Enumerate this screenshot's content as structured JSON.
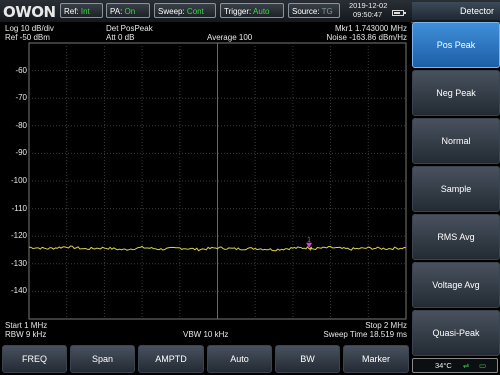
{
  "brand": {
    "logo_text": "OWON"
  },
  "topbar": {
    "ref": {
      "label": "Ref:",
      "value": "Int"
    },
    "pa": {
      "label": "PA:",
      "value": "On"
    },
    "sweep": {
      "label": "Sweep:",
      "value": "Cont"
    },
    "trigger": {
      "label": "Trigger:",
      "value": "Auto"
    },
    "source": {
      "label": "Source:",
      "value": "TG"
    },
    "date": "2019-12-02",
    "time": "09:50:47"
  },
  "menu": {
    "title": "Detector",
    "items": [
      {
        "label": "Pos Peak",
        "active": true
      },
      {
        "label": "Neg Peak"
      },
      {
        "label": "Normal"
      },
      {
        "label": "Sample"
      },
      {
        "label": "RMS Avg"
      },
      {
        "label": "Voltage Avg"
      },
      {
        "label": "Quasi-Peak"
      }
    ]
  },
  "screen_header": {
    "scale": "Log 10 dB/div",
    "ref_level": "Ref -50 dBm",
    "detector": "Det PosPeak",
    "attenuation": "Att 0 dB",
    "average": "Average 100",
    "marker_freq": "Mkr1  1.743000 MHz",
    "noise": "Noise  -163.86 dBm/Hz"
  },
  "screen_footer": {
    "start": "Start 1 MHz",
    "rbw": "RBW 9 kHz",
    "vbw": "VBW 10 kHz",
    "stop": "Stop 2 MHz",
    "sweep_time": "Sweep Time 18.519 ms"
  },
  "bottom_menu": [
    {
      "label": "FREQ"
    },
    {
      "label": "Span"
    },
    {
      "label": "AMPTD"
    },
    {
      "label": "Auto"
    },
    {
      "label": "BW"
    },
    {
      "label": "Marker"
    }
  ],
  "status": {
    "temperature": "34°C"
  },
  "marker": {
    "label": "1"
  },
  "colors": {
    "trace": "#d8d24a",
    "marker": "#e040d0",
    "active_button": "#2f7fcf",
    "status_green": "#3fd34a"
  },
  "chart_data": {
    "type": "line",
    "title": "",
    "xlabel": "",
    "ylabel": "",
    "x_unit": "MHz",
    "y_unit": "dBm",
    "xlim": [
      1,
      2
    ],
    "ylim": [
      -150,
      -50
    ],
    "y_ticks": [
      -60,
      -70,
      -80,
      -90,
      -100,
      -110,
      -120,
      -130,
      -140
    ],
    "grid": true,
    "series": [
      {
        "x": [
          1.0,
          1.05,
          1.1,
          1.15,
          1.2,
          1.25,
          1.3,
          1.35,
          1.4,
          1.45,
          1.5,
          1.55,
          1.6,
          1.65,
          1.7,
          1.743,
          1.75,
          1.8,
          1.85,
          1.9,
          1.95,
          2.0
        ],
        "y": [
          -124,
          -124.5,
          -123.8,
          -124.6,
          -124.2,
          -124.9,
          -124.1,
          -124.7,
          -124.3,
          -124.8,
          -124.2,
          -124.6,
          -124.4,
          -124.9,
          -124.3,
          -124.2,
          -124.6,
          -124.1,
          -124.7,
          -124.3,
          -124.5,
          -124.2
        ]
      }
    ],
    "markers": [
      {
        "label": "1",
        "x": 1.743,
        "y": -124.2
      }
    ]
  }
}
